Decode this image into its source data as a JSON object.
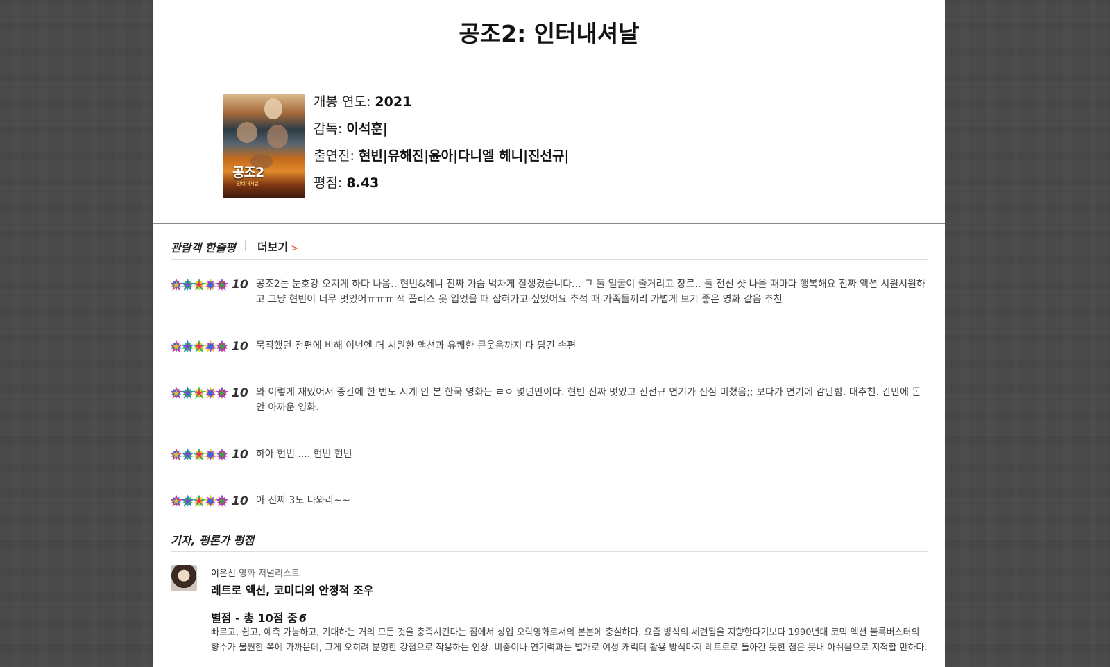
{
  "movie": {
    "title": "공조2: 인터내셔날",
    "poster_logo": "공조2",
    "poster_sub": "인터내셔날",
    "info": [
      {
        "label": "개봉 연도: ",
        "value": "2021"
      },
      {
        "label": "감독: ",
        "value": "이석훈|"
      },
      {
        "label": "출연진: ",
        "value": "현빈|유해진|윤아|다니엘 헤니|진선규|"
      },
      {
        "label": "평점: ",
        "value": "8.43"
      }
    ]
  },
  "audience": {
    "heading": "관람객 한줄평",
    "more_label": "더보기",
    "more_chevron": ">",
    "reviews": [
      {
        "score": "10",
        "stars": 5,
        "text": "공조2는 눈호강 오지게 하다 나옴.. 현빈&헤니 진짜 가슴 벅차게 잘생겼습니다... 그 둘 얼굴이 줄거리고 장르.. 둘 전신 샷 나올 때마다 행복해요 진짜 액션 시원시원하고 그냥 현빈이 너무 멋있어ㅠㅠㅠ 잭 폴리스 옷 입었을 때 잡혀가고 싶었어요 추석 때 가족들끼리 가볍게 보기 좋은 영화 같음 추천"
      },
      {
        "score": "10",
        "stars": 5,
        "text": "묵직했던 전편에 비해 이번엔 더 시원한 액션과 유쾌한 큰웃음까지 다 담긴 속편"
      },
      {
        "score": "10",
        "stars": 5,
        "text": "와 이렇게 재밌어서 중간에 한 번도 시계 안 본 한국 영화는 ㄹㅇ 몇년만이다. 현빈 진짜 멋있고 진선규 연기가 진심 미쳤음;; 보다가 연기에 감탄함. 대추천. 간만에 돈 안 아까운 영화."
      },
      {
        "score": "10",
        "stars": 5,
        "text": "하아 현빈 .... 현빈 현빈"
      },
      {
        "score": "10",
        "stars": 5,
        "text": "아 진짜 3도 나와라~~"
      }
    ]
  },
  "critics": {
    "heading": "기자, 평론가 평점",
    "items": [
      {
        "name": "이은선",
        "job": "영화 저널리스트",
        "headline": "레트로 액션, 코미디의 안정적 조우",
        "rating_label": "별점 - 총 10점 중",
        "rating": "6",
        "body": "빠르고, 쉽고, 예측 가능하고, 기대하는 거의 모든 것을 충족시킨다는 점에서 상업 오락영화로서의 본분에 충실하다. 요즘 방식의 세련됨을 지향한다기보다 1990년대 코믹 액션 블록버스터의 향수가 물씬한 쪽에 가까운데, 그게 오히려 분명한 강점으로 작용하는 인상. 비중이나 연기력과는 별개로 여성 캐릭터 활용 방식마저 레트로로 돌아간 듯한 점은 못내 아쉬움으로 지적할 만하다."
      }
    ]
  },
  "colors": {
    "accent": "#e84a2e",
    "background": "#4a4a4a",
    "sheet": "#ffffff",
    "star_palette": [
      "#e0207a",
      "#2a6fe0",
      "#26b34a",
      "#f2c21b",
      "#8a3ad8"
    ]
  }
}
